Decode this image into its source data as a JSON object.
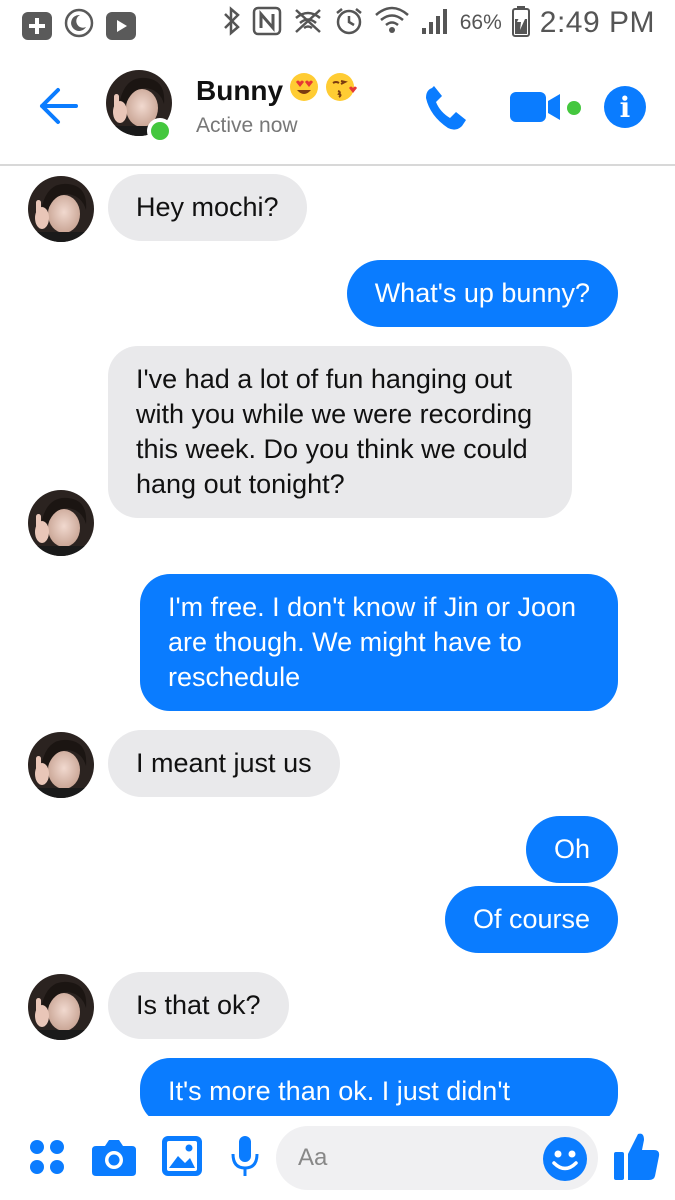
{
  "status_bar": {
    "battery": "66%",
    "time": "2:49 PM"
  },
  "header": {
    "contact_name": "Bunny",
    "status": "Active now",
    "emojis": [
      "heart-eyes",
      "kissing-heart"
    ]
  },
  "messages": [
    {
      "side": "in",
      "text": "Hey mochi?"
    },
    {
      "side": "out",
      "text": "What's up bunny?"
    },
    {
      "side": "in",
      "text": "I've had a lot of fun hanging out with you while we were recording this week. Do you think we could hang out tonight?"
    },
    {
      "side": "out",
      "text": "I'm free. I don't know if Jin or Joon are though. We might have to reschedule"
    },
    {
      "side": "in",
      "text": "I meant just us"
    },
    {
      "side": "out",
      "text": "Oh"
    },
    {
      "side": "out",
      "text": "Of course"
    },
    {
      "side": "in",
      "text": "Is that ok?"
    },
    {
      "side": "out",
      "text": "It's more than ok. I just didn't"
    }
  ],
  "composer": {
    "placeholder": "Aa"
  },
  "colors": {
    "accent": "#0a7cff",
    "incoming_bubble": "#e9e9eb",
    "active_green": "#44c73e"
  }
}
